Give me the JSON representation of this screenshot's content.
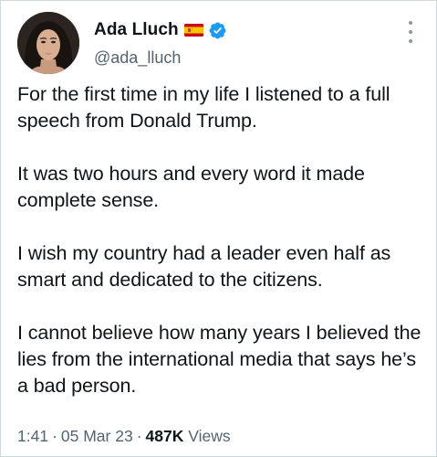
{
  "author": {
    "display_name": "Ada Lluch",
    "handle": "@ada_lluch",
    "flag_icon": "spain-flag-icon",
    "verified_icon": "verified-badge-icon",
    "verified_color": "#1d9bf0"
  },
  "more_icon": "more-vertical-icon",
  "tweet": {
    "paragraphs": [
      "For the first time in my life I listened to a full speech from Donald Trump.",
      "It was two hours and every word it made complete sense.",
      "I wish my country had a leader even half as smart and dedicated to the citizens.",
      "I cannot believe how many years I believed the lies from the international media that says he’s a bad person."
    ]
  },
  "meta": {
    "time": "1:41",
    "date": "05 Mar 23",
    "views_count": "487K",
    "views_label": "Views",
    "separator": "·"
  },
  "colors": {
    "text": "#0f1419",
    "secondary": "#536471",
    "border": "#cfd9de"
  }
}
